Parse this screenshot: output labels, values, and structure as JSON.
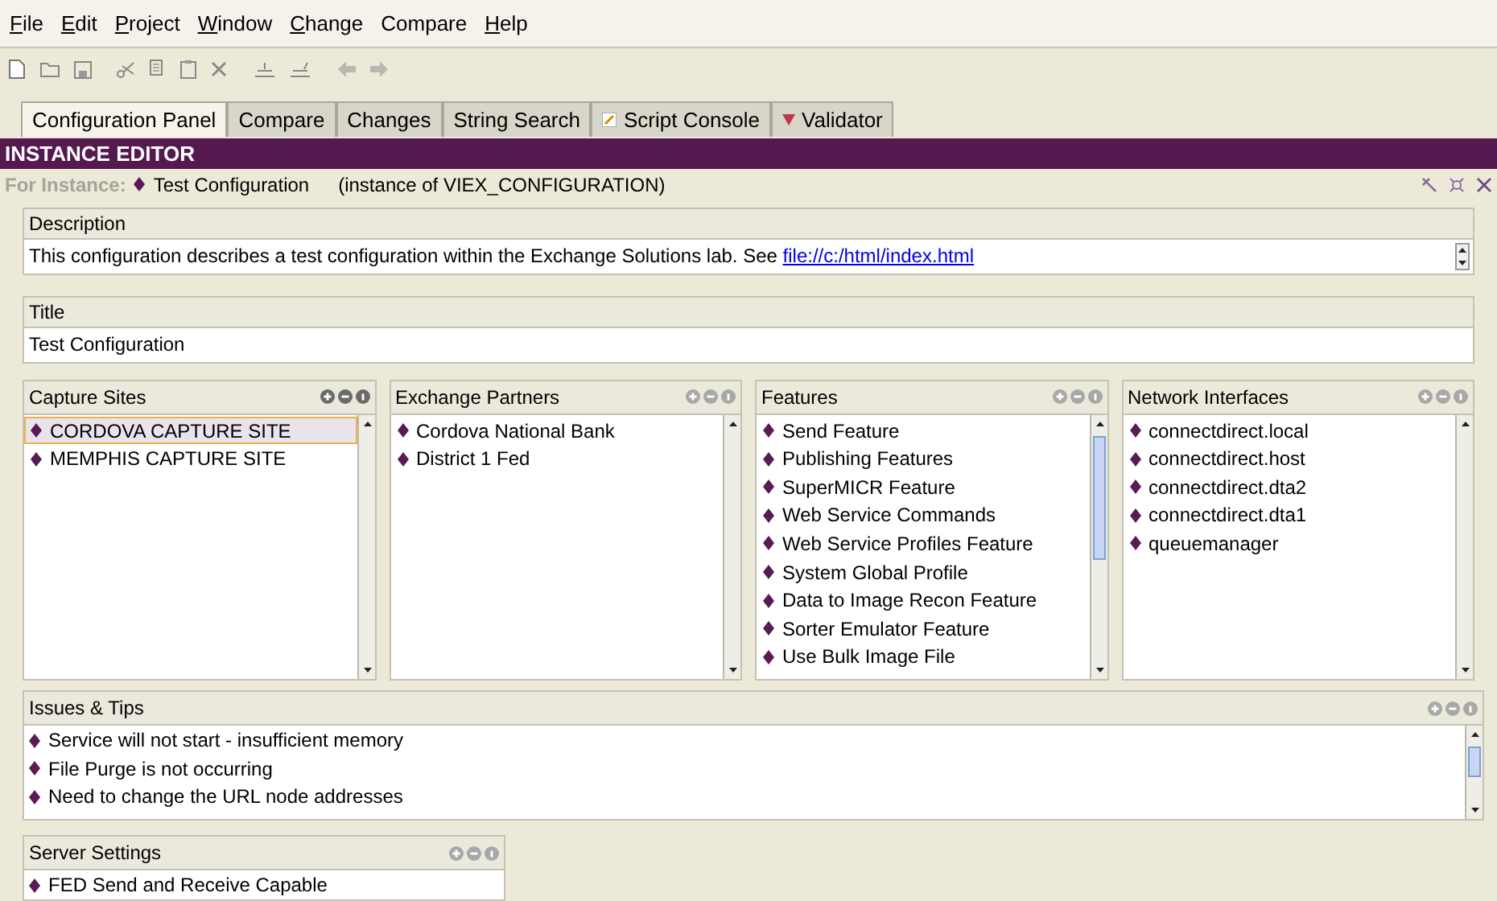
{
  "menu": [
    {
      "label": "File",
      "mnemonic": true
    },
    {
      "label": "Edit",
      "mnemonic": true
    },
    {
      "label": "Project",
      "mnemonic": true
    },
    {
      "label": "Window",
      "mnemonic": true
    },
    {
      "label": "Change",
      "mnemonic": true
    },
    {
      "label": "Compare",
      "mnemonic": false
    },
    {
      "label": "Help",
      "mnemonic": true
    }
  ],
  "tabs": [
    {
      "label": "Configuration Panel",
      "selected": true,
      "kind": "plain"
    },
    {
      "label": "Compare",
      "selected": false,
      "kind": "plain"
    },
    {
      "label": "Changes",
      "selected": false,
      "kind": "plain"
    },
    {
      "label": "String Search",
      "selected": false,
      "kind": "plain"
    },
    {
      "label": "Script Console",
      "selected": false,
      "kind": "script"
    },
    {
      "label": "Validator",
      "selected": false,
      "kind": "validator"
    }
  ],
  "editor": {
    "title": "INSTANCE EDITOR",
    "for_label": "For Instance:",
    "instance": "Test Configuration",
    "instance_of": "(instance of VIEX_CONFIGURATION)"
  },
  "description": {
    "label": "Description",
    "text": "This configuration describes a test configuration within the Exchange Solutions lab. See ",
    "link": "file://c:/html/index.html"
  },
  "title_field": {
    "label": "Title",
    "value": "Test Configuration"
  },
  "panels": [
    {
      "title": "Capture Sites",
      "active": true,
      "items": [
        {
          "label": "CORDOVA CAPTURE SITE",
          "selected": true
        },
        {
          "label": "MEMPHIS CAPTURE SITE",
          "selected": false
        }
      ]
    },
    {
      "title": "Exchange Partners",
      "active": false,
      "items": [
        {
          "label": "Cordova National Bank",
          "selected": false
        },
        {
          "label": "District 1 Fed",
          "selected": false
        }
      ]
    },
    {
      "title": "Features",
      "active": false,
      "items": [
        {
          "label": "Send Feature",
          "selected": false
        },
        {
          "label": "Publishing Features",
          "selected": false
        },
        {
          "label": "SuperMICR Feature",
          "selected": false
        },
        {
          "label": "Web Service Commands",
          "selected": false
        },
        {
          "label": "Web Service Profiles Feature",
          "selected": false
        },
        {
          "label": "System Global Profile",
          "selected": false
        },
        {
          "label": "Data to Image Recon Feature",
          "selected": false
        },
        {
          "label": "Sorter Emulator Feature",
          "selected": false
        },
        {
          "label": "Use Bulk Image File",
          "selected": false
        }
      ]
    },
    {
      "title": "Network Interfaces",
      "active": false,
      "items": [
        {
          "label": "connectdirect.local",
          "selected": false
        },
        {
          "label": "connectdirect.host",
          "selected": false
        },
        {
          "label": "connectdirect.dta2",
          "selected": false
        },
        {
          "label": "connectdirect.dta1",
          "selected": false
        },
        {
          "label": "queuemanager",
          "selected": false
        }
      ]
    }
  ],
  "issues": {
    "title": "Issues & Tips",
    "items": [
      {
        "label": "Service will not start - insufficient memory"
      },
      {
        "label": "File Purge is not occurring"
      },
      {
        "label": "Need to change the URL node addresses"
      }
    ]
  },
  "server_settings": {
    "title": "Server Settings",
    "items": [
      {
        "label": "FED Send and Receive Capable"
      }
    ]
  }
}
